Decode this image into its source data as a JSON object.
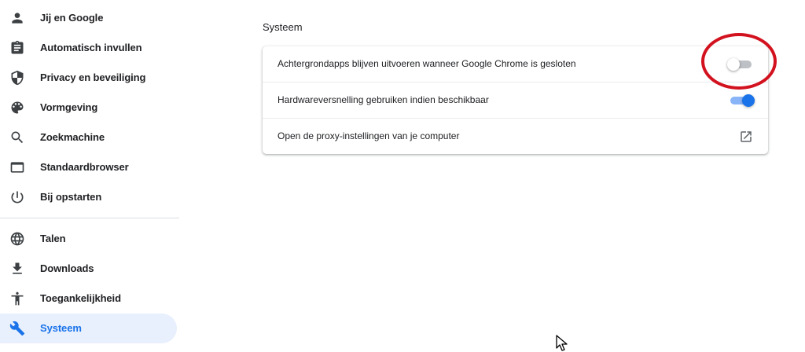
{
  "sidebar": {
    "items": [
      {
        "label": "Jij en Google",
        "icon": "person-icon"
      },
      {
        "label": "Automatisch invullen",
        "icon": "clipboard-icon"
      },
      {
        "label": "Privacy en beveiliging",
        "icon": "shield-icon"
      },
      {
        "label": "Vormgeving",
        "icon": "palette-icon"
      },
      {
        "label": "Zoekmachine",
        "icon": "search-icon"
      },
      {
        "label": "Standaardbrowser",
        "icon": "browser-window-icon"
      },
      {
        "label": "Bij opstarten",
        "icon": "power-icon"
      },
      {
        "label": "Talen",
        "icon": "globe-icon"
      },
      {
        "label": "Downloads",
        "icon": "download-icon"
      },
      {
        "label": "Toegankelijkheid",
        "icon": "accessibility-icon"
      },
      {
        "label": "Systeem",
        "icon": "wrench-icon",
        "active": true
      }
    ]
  },
  "main": {
    "section_title": "Systeem",
    "settings": [
      {
        "label": "Achtergrondapps blijven uitvoeren wanneer Google Chrome is gesloten",
        "control": "toggle",
        "state": "off"
      },
      {
        "label": "Hardwareversnelling gebruiken indien beschikbaar",
        "control": "toggle",
        "state": "on"
      },
      {
        "label": "Open de proxy-instellingen van je computer",
        "control": "external-link",
        "icon": "open-in-new-icon"
      }
    ]
  },
  "colors": {
    "accent": "#1a73e8",
    "active_nav_bg": "#e8f0fe",
    "annotation": "#d3121f"
  }
}
